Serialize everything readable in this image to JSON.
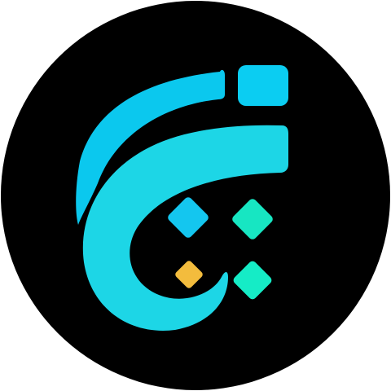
{
  "logo": {
    "icon": "stylized-letter-logo-icon",
    "colors": {
      "background_circle": "#000000",
      "outer_arc": "#0bc8ee",
      "top_square": "#0bcdf2",
      "main_curve": "#1dd6e6",
      "diamond_blue": "#14c6ef",
      "diamond_teal": "#17e6c2",
      "diamond_yellow": "#f3bc3d",
      "diamond_mint": "#15ecc6"
    }
  }
}
